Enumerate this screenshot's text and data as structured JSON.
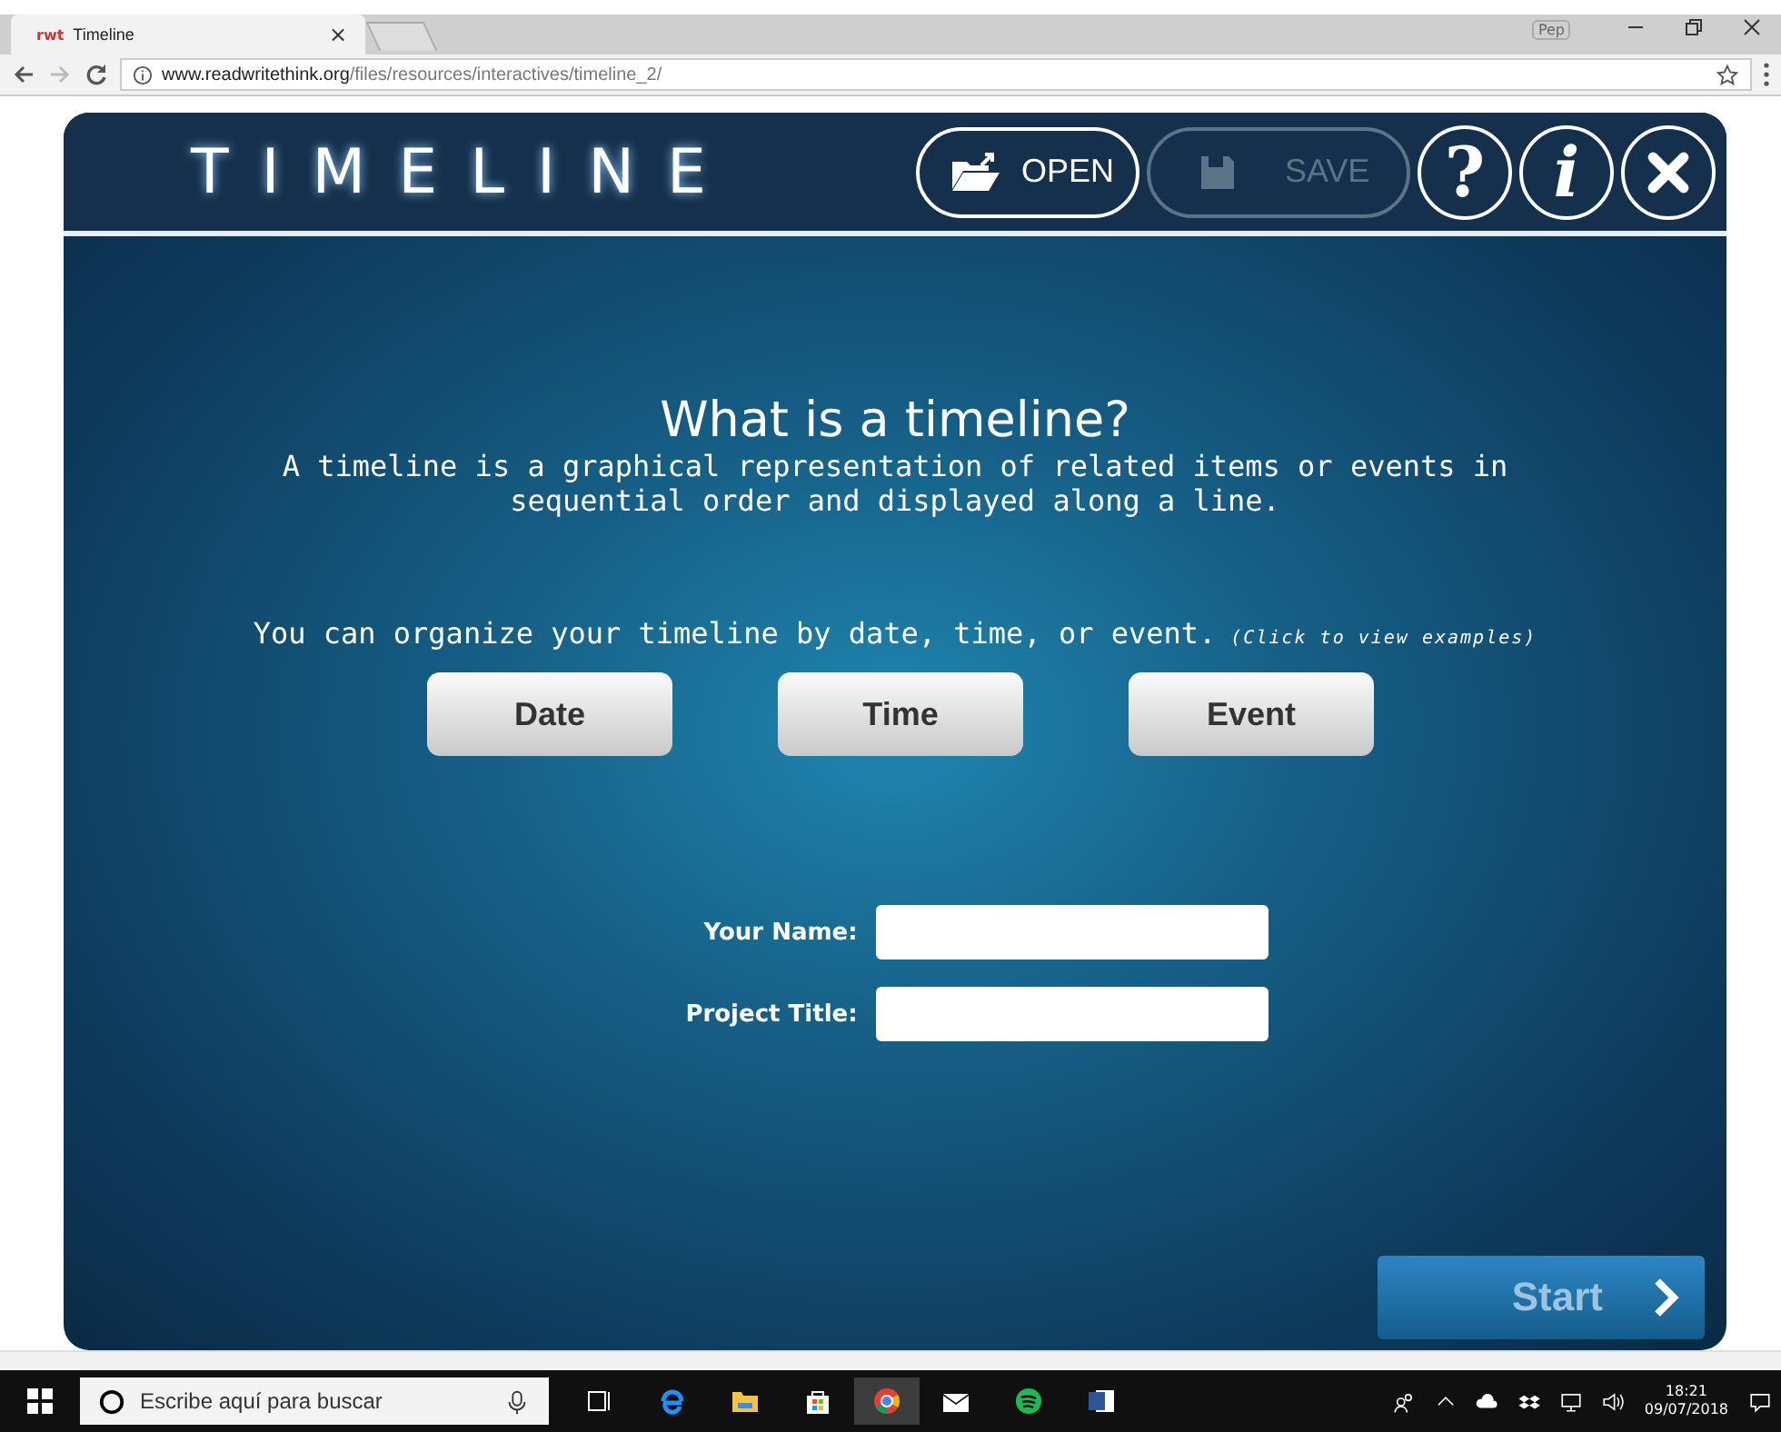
{
  "browser": {
    "tab": {
      "favicon": "rwt",
      "title": "Timeline",
      "close": "×"
    },
    "profile": "Pep",
    "url_domain": "www.readwritethink.org",
    "url_path": "/files/resources/interactives/timeline_2/"
  },
  "app": {
    "logo": "TIMELINE",
    "toolbar": [
      {
        "kind": "open",
        "label": "OPEN",
        "disabled": false
      },
      {
        "kind": "save",
        "label": "SAVE",
        "disabled": true
      },
      {
        "kind": "help",
        "label": "?",
        "disabled": false
      },
      {
        "kind": "info",
        "label": "i",
        "disabled": false
      },
      {
        "kind": "close",
        "disabled": false
      }
    ],
    "heading": "What is a timeline?",
    "definition": "A timeline is a graphical representation of related items or events in sequential order and displayed along a line.",
    "organize_text": "You can organize your timeline by date, time, or event.",
    "organize_hint": "(Click to view examples)",
    "type_buttons": [
      "Date",
      "Time",
      "Event"
    ],
    "fields": [
      {
        "label": "Your Name:"
      },
      {
        "label": "Project Title:"
      }
    ],
    "start_button": "Start"
  },
  "taskbar": {
    "search_placeholder": "Escribe aquí para buscar",
    "time": "18:21",
    "date": "09/07/2018"
  }
}
